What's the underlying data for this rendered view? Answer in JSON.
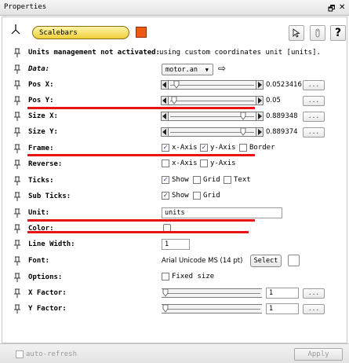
{
  "window": {
    "title": "Properties",
    "float_glyph": "🗗",
    "close_glyph": "✕"
  },
  "header": {
    "object_name": "Scalebars",
    "swatch_color": "#ee5a14",
    "help_label": "?"
  },
  "info": {
    "label": "Units management not activated:",
    "note": "using custom coordinates unit [units]."
  },
  "rows": {
    "data": {
      "label": "Data:",
      "value": "motor.an",
      "arrow": "⇨"
    },
    "pos_x": {
      "label": "Pos X:",
      "value": "0.0523416",
      "dots": "...",
      "thumb_fraction": 0.05
    },
    "pos_y": {
      "label": "Pos Y:",
      "value": "0.05",
      "dots": "...",
      "thumb_fraction": 0.02
    },
    "size_x": {
      "label": "Size X:",
      "value": "0.889348",
      "dots": "...",
      "thumb_fraction": 0.89
    },
    "size_y": {
      "label": "Size Y:",
      "value": "0.889374",
      "dots": "...",
      "thumb_fraction": 0.89
    },
    "frame": {
      "label": "Frame:",
      "options": [
        "x-Axis",
        "y-Axis",
        "Border"
      ],
      "checked": [
        true,
        true,
        false
      ]
    },
    "reverse": {
      "label": "Reverse:",
      "options": [
        "x-Axis",
        "y-Axis"
      ],
      "checked": [
        false,
        false
      ]
    },
    "ticks": {
      "label": "Ticks:",
      "options": [
        "Show",
        "Grid",
        "Text"
      ],
      "checked": [
        true,
        false,
        false
      ]
    },
    "sub_ticks": {
      "label": "Sub Ticks:",
      "options": [
        "Show",
        "Grid"
      ],
      "checked": [
        true,
        false
      ]
    },
    "unit": {
      "label": "Unit:",
      "value": "units"
    },
    "color": {
      "label": "Color:"
    },
    "line_width": {
      "label": "Line Width:",
      "value": "1"
    },
    "font": {
      "label": "Font:",
      "value": "Arial Unicode MS (14 pt)",
      "select_label": "Select"
    },
    "options": {
      "label": "Options:",
      "options": [
        "Fixed size"
      ],
      "checked": [
        false
      ]
    },
    "x_factor": {
      "label": "X Factor:",
      "value": "1",
      "dots": "...",
      "thumb_fraction": 0.0
    },
    "y_factor": {
      "label": "Y Factor:",
      "value": "1",
      "dots": "...",
      "thumb_fraction": 0.0
    }
  },
  "footer": {
    "auto_refresh_label": "auto-refresh",
    "apply_label": "Apply"
  },
  "annotation_color": "#e81414"
}
